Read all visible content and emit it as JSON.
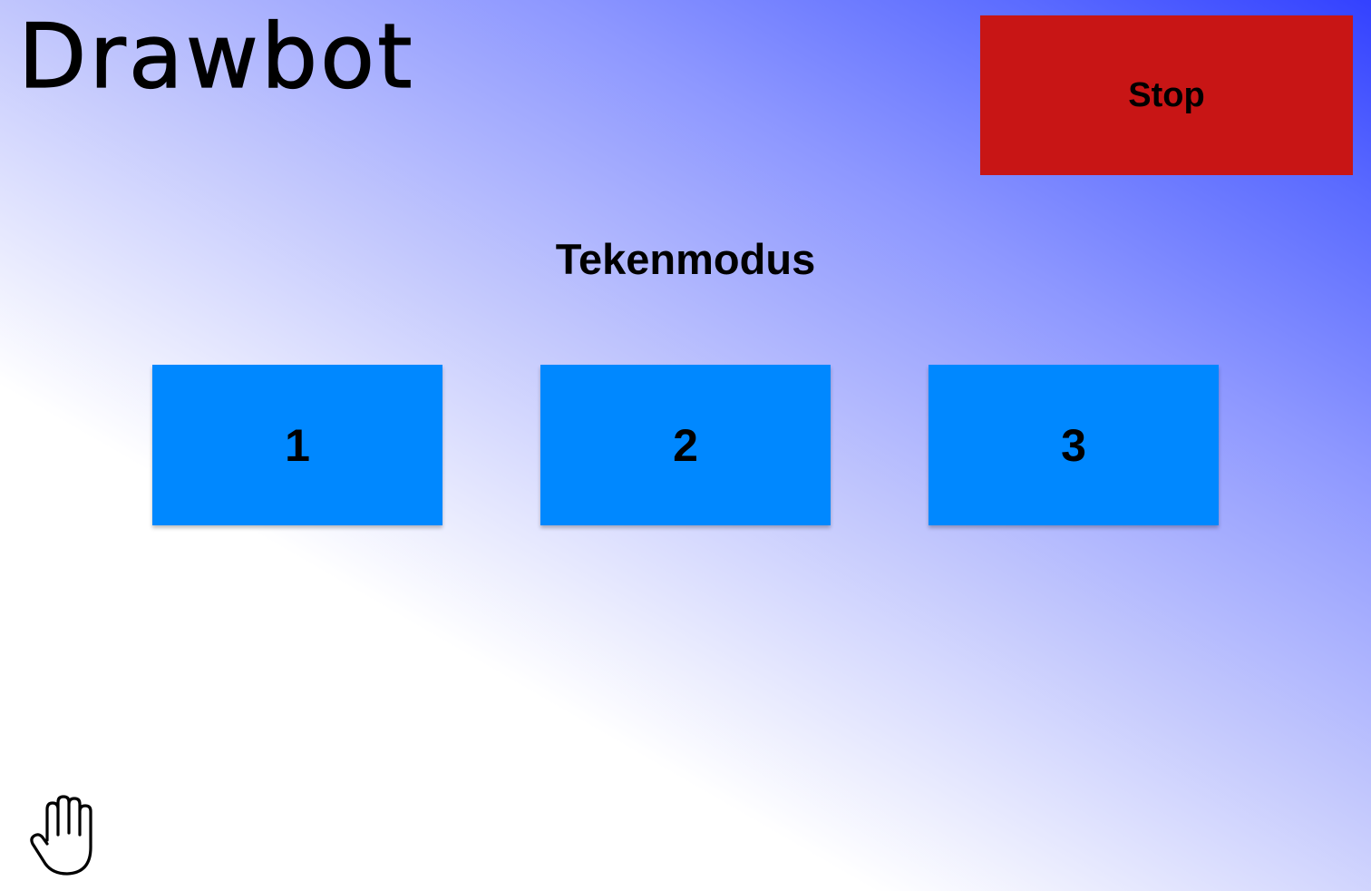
{
  "app": {
    "logo_text": "Drawbot"
  },
  "controls": {
    "stop_label": "Stop",
    "stop_color": "#c81515"
  },
  "mode_section": {
    "title": "Tekenmodus",
    "buttons": [
      {
        "label": "1"
      },
      {
        "label": "2"
      },
      {
        "label": "3"
      }
    ],
    "button_color": "#0088ff"
  },
  "icons": {
    "bottom_left": "hand-icon"
  }
}
